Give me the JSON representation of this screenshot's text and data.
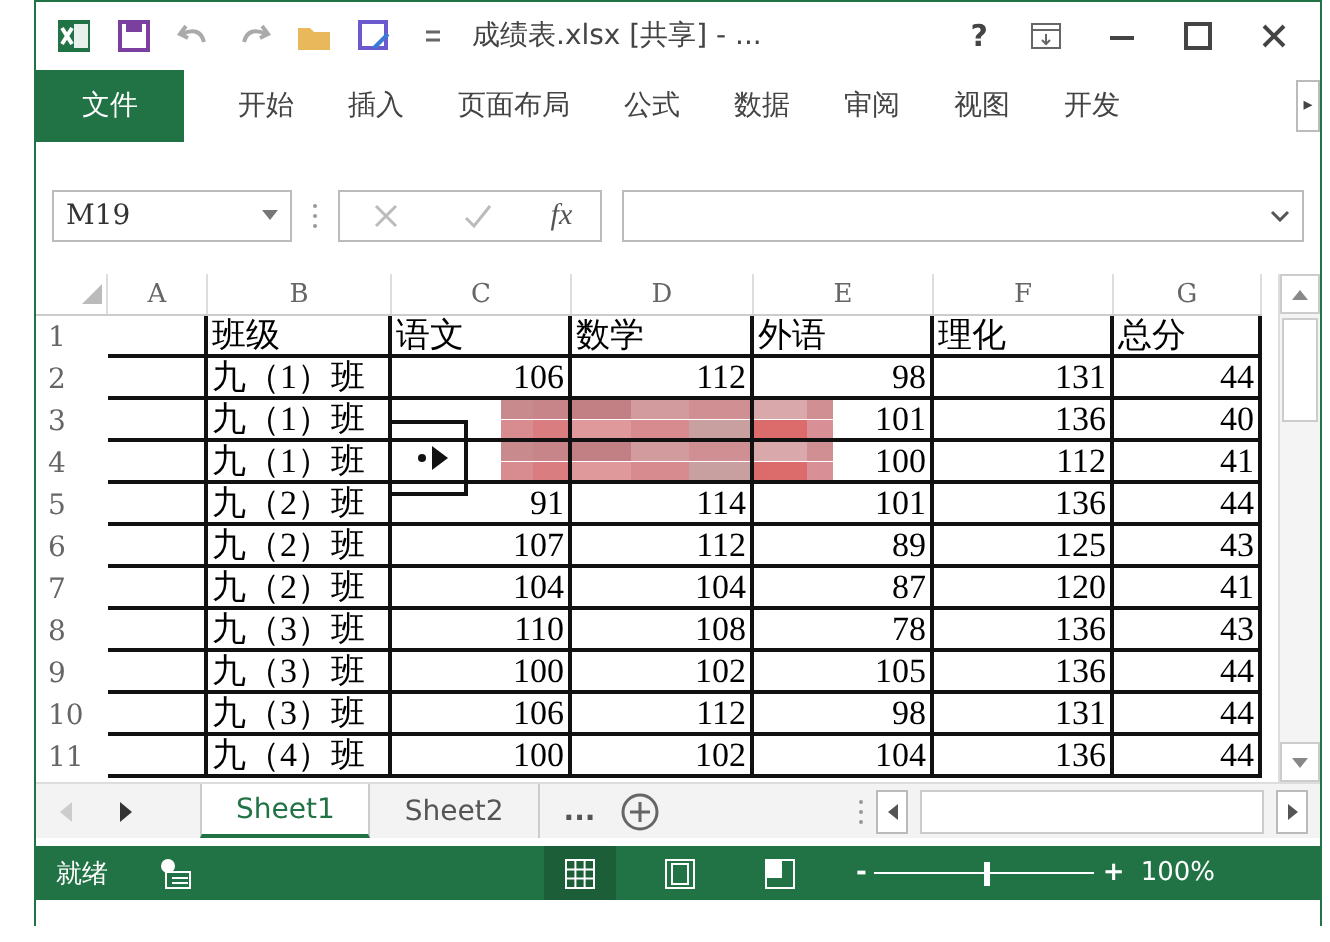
{
  "window": {
    "title": "成绩表.xlsx  [共享] - ...",
    "help": "?"
  },
  "ribbon": {
    "file_tab": "文件",
    "tabs": [
      "开始",
      "插入",
      "页面布局",
      "公式",
      "数据",
      "审阅",
      "视图",
      "开发"
    ],
    "scroll": "▸"
  },
  "formula_bar": {
    "name_box": "M19",
    "fx": "fx"
  },
  "sheet": {
    "columns": [
      "A",
      "B",
      "C",
      "D",
      "E",
      "F",
      "G"
    ],
    "rows": [
      {
        "n": "1",
        "cells": [
          "",
          "班级",
          "语文",
          "数学",
          "外语",
          "理化",
          "总分"
        ]
      },
      {
        "n": "2",
        "cells": [
          "",
          "九（1）班",
          "106",
          "112",
          "98",
          "131",
          "44"
        ]
      },
      {
        "n": "3",
        "cells": [
          "",
          "九（1）班",
          null,
          null,
          "101",
          "136",
          "40"
        ]
      },
      {
        "n": "4",
        "cells": [
          "",
          "九（1）班",
          null,
          null,
          "100",
          "112",
          "41"
        ]
      },
      {
        "n": "5",
        "cells": [
          "",
          "九（2）班",
          "91",
          "114",
          "101",
          "136",
          "44"
        ]
      },
      {
        "n": "6",
        "cells": [
          "",
          "九（2）班",
          "107",
          "112",
          "89",
          "125",
          "43"
        ]
      },
      {
        "n": "7",
        "cells": [
          "",
          "九（2）班",
          "104",
          "104",
          "87",
          "120",
          "41"
        ]
      },
      {
        "n": "8",
        "cells": [
          "",
          "九（3）班",
          "110",
          "108",
          "78",
          "136",
          "43"
        ]
      },
      {
        "n": "9",
        "cells": [
          "",
          "九（3）班",
          "100",
          "102",
          "105",
          "136",
          "44"
        ]
      },
      {
        "n": "10",
        "cells": [
          "",
          "九（3）班",
          "106",
          "112",
          "98",
          "131",
          "44"
        ]
      },
      {
        "n": "11",
        "cells": [
          "",
          "九（4）班",
          "100",
          "102",
          "104",
          "136",
          "44"
        ]
      }
    ]
  },
  "sheet_tabs": {
    "more": "...",
    "tabs": [
      {
        "label": "Sheet1",
        "selected": true
      },
      {
        "label": "Sheet2",
        "selected": false
      }
    ]
  },
  "status_bar": {
    "status": "就绪",
    "views": [
      {
        "kind": "normal",
        "selected": true
      },
      {
        "kind": "layout",
        "selected": false
      },
      {
        "kind": "break",
        "selected": false
      }
    ],
    "zoom_minus": "-",
    "zoom_plus": "+",
    "zoom": {
      "level": 0.5
    },
    "zoom_text": "100%"
  }
}
